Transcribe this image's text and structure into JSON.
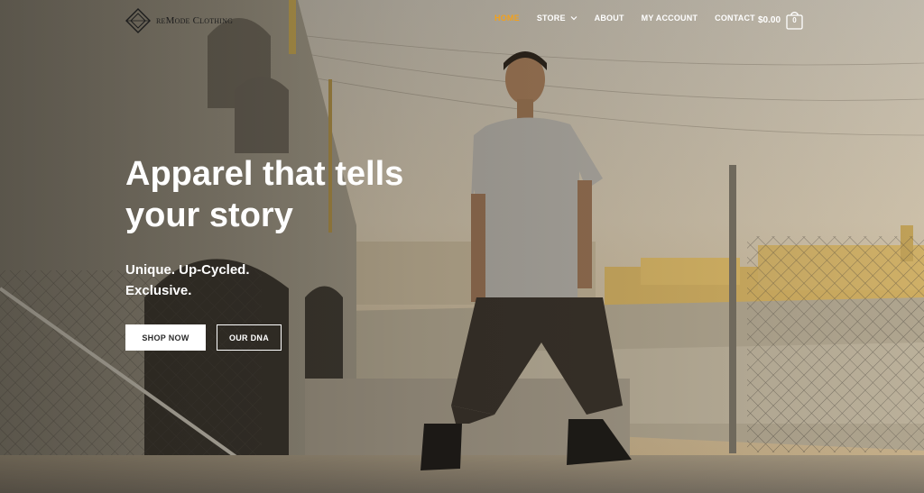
{
  "brand": {
    "name": "reMode Clothing",
    "logo_icon": "diamond-logo-icon"
  },
  "nav": {
    "items": [
      {
        "label": "HOME",
        "active": true
      },
      {
        "label": "STORE",
        "has_dropdown": true
      },
      {
        "label": "ABOUT"
      },
      {
        "label": "MY ACCOUNT"
      },
      {
        "label": "CONTACT"
      }
    ],
    "active_color": "#f2a11c"
  },
  "cart": {
    "total": "$0.00",
    "count": "0",
    "icon": "shopping-bag-icon"
  },
  "hero": {
    "title": "Apparel that tells\nyour story",
    "subtitle": "Unique. Up-Cycled.\nExclusive.",
    "primary_button": "SHOP NOW",
    "secondary_button": "OUR DNA"
  }
}
